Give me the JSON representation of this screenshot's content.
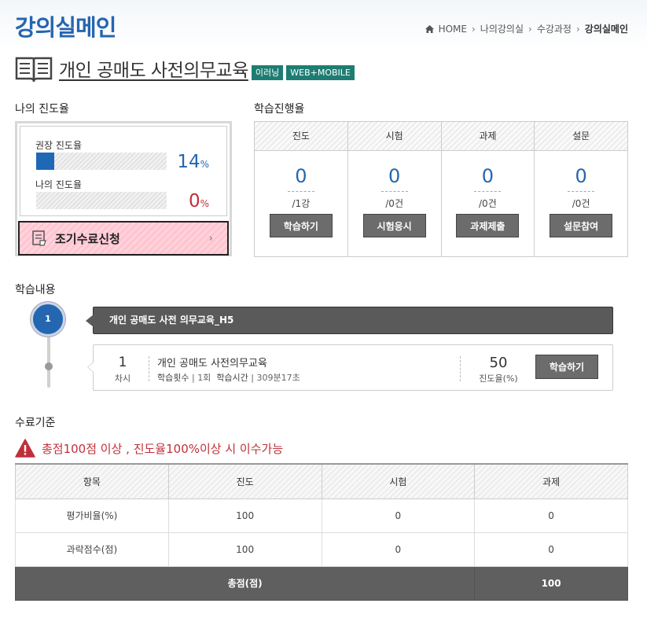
{
  "header": {
    "title": "강의실메인",
    "breadcrumb": [
      "HOME",
      "나의강의실",
      "수강과정",
      "강의실메인"
    ]
  },
  "course": {
    "title": "개인 공매도 사전의무교육",
    "badges": [
      "이러닝",
      "WEB+MOBILE"
    ]
  },
  "my_progress": {
    "section_label": "나의 진도율",
    "recommended_label": "권장 진도율",
    "recommended_value": "14",
    "recommended_fraction": 0.14,
    "my_label": "나의 진도율",
    "my_value": "0",
    "my_fraction": 0,
    "unit": "%",
    "early_button": "조기수료신청"
  },
  "learning_rate": {
    "section_label": "학습진행율",
    "columns": [
      {
        "head": "진도",
        "value": "0",
        "total": "/1강",
        "button": "학습하기"
      },
      {
        "head": "시험",
        "value": "0",
        "total": "/0건",
        "button": "시험응시"
      },
      {
        "head": "과제",
        "value": "0",
        "total": "/0건",
        "button": "과제제출"
      },
      {
        "head": "설문",
        "value": "0",
        "total": "/0건",
        "button": "설문참여"
      }
    ]
  },
  "contents": {
    "section_label": "학습내용",
    "chapter_num": "1",
    "chapter_title": "개인 공매도 사전 의무교육_H5",
    "lesson": {
      "num": "1",
      "num_label": "차시",
      "title": "개인 공매도 사전의무교육",
      "count_label": "학습횟수",
      "count_value": "1회",
      "time_label": "학습시간",
      "time_value": "309분17초",
      "pct": "50",
      "pct_label": "진도율(%)",
      "button": "학습하기"
    }
  },
  "criteria": {
    "section_label": "수료기준",
    "message": "총점100점 이상 , 진도율100%이상 시 이수가능",
    "headers": [
      "항목",
      "진도",
      "시험",
      "과제"
    ],
    "rows": [
      [
        "평가비율(%)",
        "100",
        "0",
        "0"
      ],
      [
        "과락점수(점)",
        "100",
        "0",
        "0"
      ]
    ],
    "total_label": "총점(점)",
    "total_value": "100"
  },
  "colors": {
    "accent": "#2566b0",
    "warning": "#c0303a",
    "badge": "#1e7d73"
  }
}
